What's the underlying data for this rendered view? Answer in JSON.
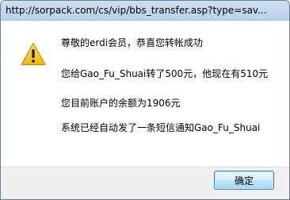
{
  "window": {
    "title": "http://sorpack.com/cs/vip/bbs_transfer.asp?type=sav..."
  },
  "dialog": {
    "icon": "warning-icon",
    "messages": [
      "尊敬的erdi会员，恭喜您转帐成功",
      "您给Gao_Fu_Shuai转了500元，他现在有510元",
      "您目前账户的余额为1906元",
      "系统已经自动发了一条短信通知Gao_Fu_Shuai"
    ],
    "ok_label": "确定"
  },
  "colors": {
    "warning_fill": "#f5c61b",
    "title_bar": "#b9d1ea",
    "button_border": "#3c7fb1"
  }
}
